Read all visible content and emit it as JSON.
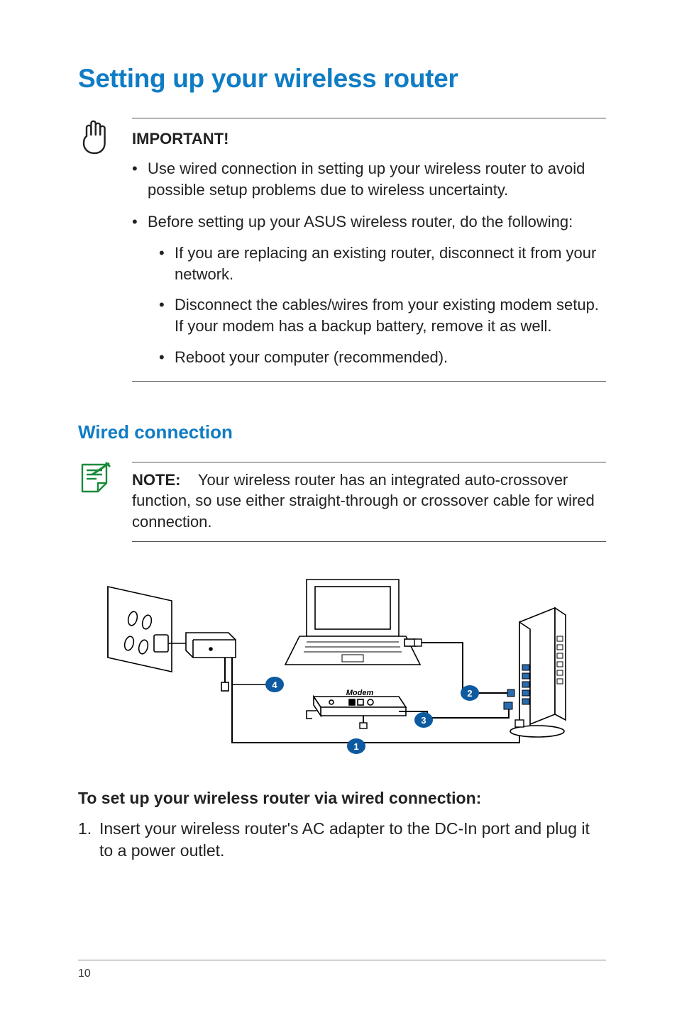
{
  "title": "Setting up your wireless router",
  "important": {
    "label": "IMPORTANT!",
    "items": [
      "Use wired connection in setting up your wireless router to avoid possible setup problems due to wireless uncertainty.",
      "Before setting up your ASUS wireless router, do the following:"
    ],
    "sub_items": [
      "If you are replacing an existing router, disconnect it from your network.",
      "Disconnect the cables/wires from your existing modem setup. If your modem has a backup battery, remove it as well.",
      "Reboot your computer (recommended)."
    ]
  },
  "section2": {
    "heading": "Wired connection",
    "note_label": "NOTE:",
    "note_text": "Your wireless router has an integrated auto-crossover function, so use either straight-through or crossover cable for wired connection."
  },
  "diagram": {
    "modem_label": "Modem",
    "callouts": [
      "1",
      "2",
      "3",
      "4"
    ]
  },
  "steps": {
    "heading": "To set up your wireless router via wired connection:",
    "items": [
      {
        "num": "1.",
        "text": "Insert your wireless router's AC adapter to the DC-In port and plug it to a power outlet."
      }
    ]
  },
  "page_number": "10"
}
